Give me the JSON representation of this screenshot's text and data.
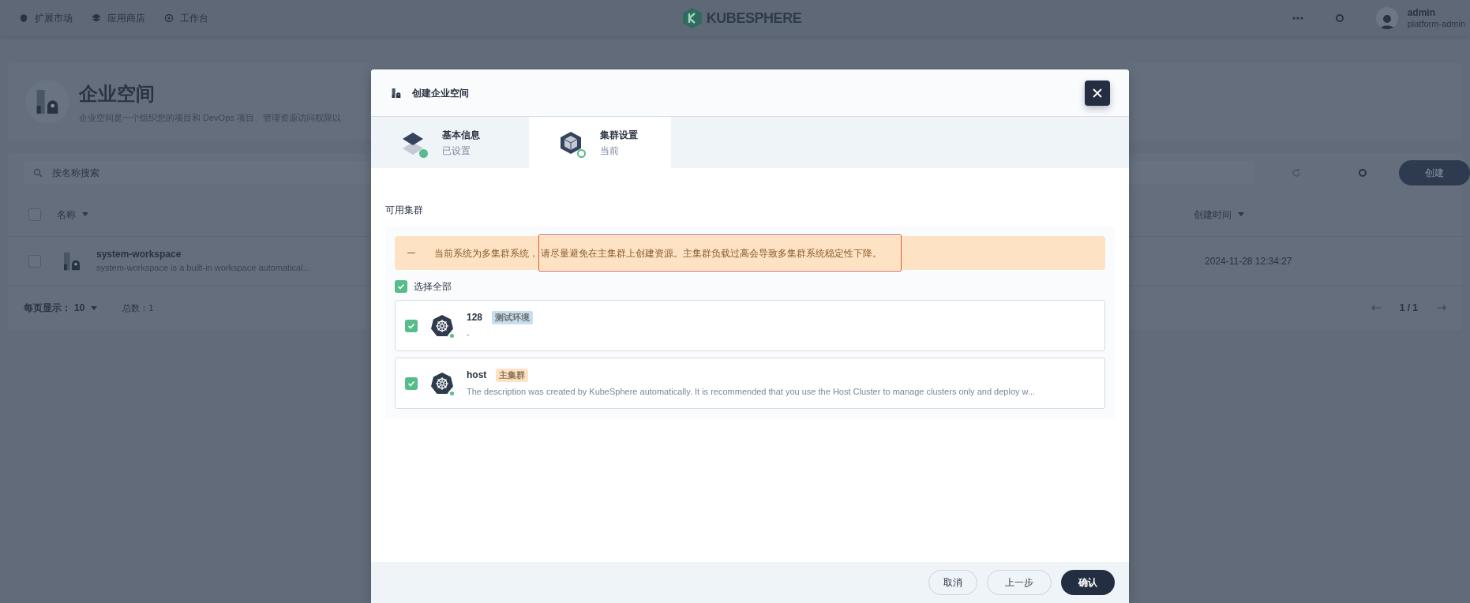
{
  "top_nav": {
    "items": [
      {
        "label": "扩展市场",
        "kind": "market"
      },
      {
        "label": "应用商店",
        "kind": "store"
      },
      {
        "label": "工作台",
        "kind": "workbench"
      }
    ],
    "logo": "KUBESPHERE",
    "user": {
      "name": "admin",
      "role": "platform-admin"
    }
  },
  "page": {
    "title": "企业空间",
    "description": "企业空间是一个组织您的项目和 DevOps 项目、管理资源访问权限以",
    "search": {
      "placeholder": "按名称搜索"
    },
    "create_button": "创建",
    "table": {
      "all_selected": false,
      "columns": [
        {
          "label": "名称"
        },
        {
          "label": "创建时间"
        }
      ],
      "rows": [
        {
          "name": "system-workspace",
          "description": "system-workspace is a built-in workspace automatical...",
          "created": "2024-11-28 12:34:27",
          "selected": false
        }
      ]
    },
    "pagination": {
      "per_page_label": "每页显示：",
      "per_page": "10",
      "total": "总数：1",
      "page": "1 / 1"
    }
  },
  "dialog": {
    "title": "创建企业空间",
    "steps": [
      {
        "title": "基本信息",
        "status": "已设置",
        "selected": false,
        "kind": "basic"
      },
      {
        "title": "集群设置",
        "status": "当前",
        "selected": true,
        "kind": "cluster"
      }
    ],
    "section_label": "可用集群",
    "warning": {
      "text": "当前系统为多集群系统，",
      "highlighted": "请尽量避免在主集群上创建资源。主集群负载过高会导致多集群系统稳定性下降。"
    },
    "select_all": {
      "label": "选择全部",
      "checked": true
    },
    "clusters": [
      {
        "name": "128",
        "tag": "测试环境",
        "color": "#c7deef",
        "description": "-",
        "checked": true
      },
      {
        "name": "host",
        "tag": "主集群",
        "color": "#fde3c4",
        "description": "The description was created by KubeSphere automatically. It is recommended that you use the Host Cluster to manage clusters only and deploy w...",
        "checked": true
      }
    ],
    "buttons": {
      "cancel": "取消",
      "back": "上一步",
      "confirm": "确认"
    }
  }
}
